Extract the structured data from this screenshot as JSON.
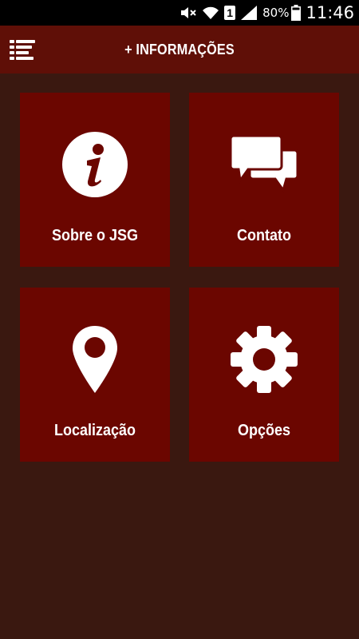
{
  "status_bar": {
    "battery_percent": "80%",
    "sim_slot": "1",
    "time": "11:46",
    "icons": [
      "mute-icon",
      "wifi-icon",
      "sim-icon",
      "signal-icon",
      "battery-icon"
    ]
  },
  "header": {
    "title": "+ INFORMAÇÕES",
    "menu_icon": "list-menu-icon"
  },
  "tiles": [
    {
      "label": "Sobre o JSG",
      "icon": "info-icon"
    },
    {
      "label": "Contato",
      "icon": "chat-bubbles-icon"
    },
    {
      "label": "Localização",
      "icon": "map-pin-icon"
    },
    {
      "label": "Opções",
      "icon": "gear-icon"
    }
  ],
  "colors": {
    "background": "#3a1810",
    "app_bar": "#5f0f07",
    "tile": "#6b0600",
    "foreground": "#ffffff"
  }
}
